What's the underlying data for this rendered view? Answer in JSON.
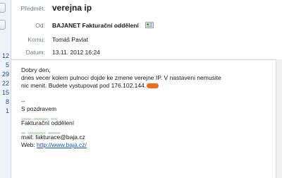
{
  "left_panel": {
    "dates": [
      "12",
      "5",
      "29",
      "22",
      "15",
      "8",
      "1"
    ]
  },
  "header": {
    "subject_label": "Předmět:",
    "subject": "verejna ip",
    "from_label": "Od:",
    "from": "BAJANET Fakturační oddělení",
    "to_label": "Komu:",
    "to": "Tomáš Pavlat",
    "date_label": "Datum:",
    "date": "13.11. 2012 16:24"
  },
  "message": {
    "greeting": "Dobry den,",
    "line1": "dnes vecer kolem pulnoci dojde ke zmene verejne IP. V nastaveni nemusite",
    "line2": "nic menit. Budete vystupovat pod 176.102.144.",
    "dashes": "--",
    "closing": "S pozdravem",
    "dept": "Fakturační oddělení",
    "mail": "mail: fakturace@baja.cz",
    "web_label": "Web: ",
    "web_link": "http://www.baja.cz/"
  },
  "colors": {
    "redaction": "#ef6c1a",
    "link": "#1a4fb5",
    "label": "#6b7a8f"
  }
}
